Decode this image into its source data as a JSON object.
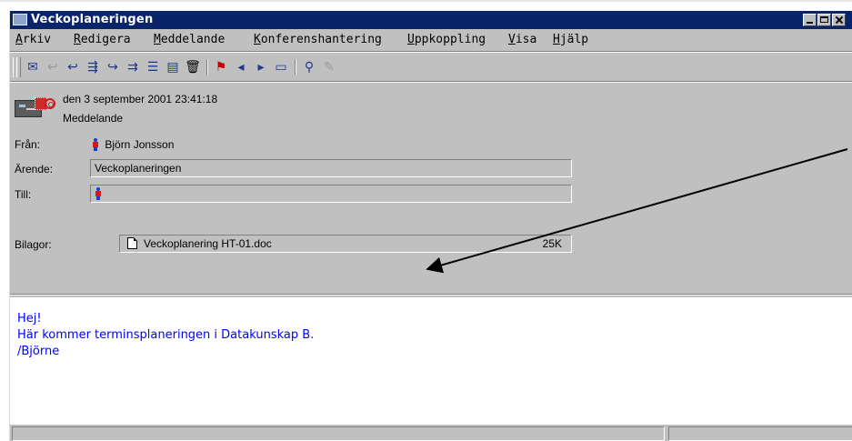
{
  "window": {
    "title": "Veckoplaneringen",
    "controls": [
      "minimize",
      "maximize",
      "close"
    ]
  },
  "menubar": {
    "items": [
      "Arkiv",
      "Redigera",
      "Meddelande",
      "Konferenshantering",
      "Uppkoppling",
      "Visa",
      "Hjälp"
    ]
  },
  "toolbar": {
    "icons": [
      "new-letter-icon",
      "reply-disabled-icon",
      "reply-icon",
      "reply-all-icon",
      "forward-icon",
      "forward-all-icon",
      "message-list-icon",
      "print-icon",
      "delete-icon",
      "next-unread-icon",
      "previous-thread-icon",
      "next-thread-icon",
      "folder-icon",
      "search-icon",
      "tools-disabled-icon"
    ]
  },
  "message": {
    "date": "den 3 september 2001 23:41:18",
    "type": "Meddelande",
    "from_label": "Från:",
    "from_value": "Björn Jonsson",
    "subject_label": "Ärende:",
    "subject_value": "Veckoplaneringen",
    "to_label": "Till:",
    "to_value": "",
    "attachments_label": "Bilagor:",
    "attachment_name": "Veckoplanering HT-01.doc",
    "attachment_size": "25K"
  },
  "body": {
    "lines": [
      "Hej!",
      "Här kommer terminsplaneringen i Datakunskap B.",
      "/Björne"
    ]
  },
  "colors": {
    "titlebar": "#0a246a",
    "chrome": "#c0c0c0",
    "body_text": "#0000ff"
  }
}
